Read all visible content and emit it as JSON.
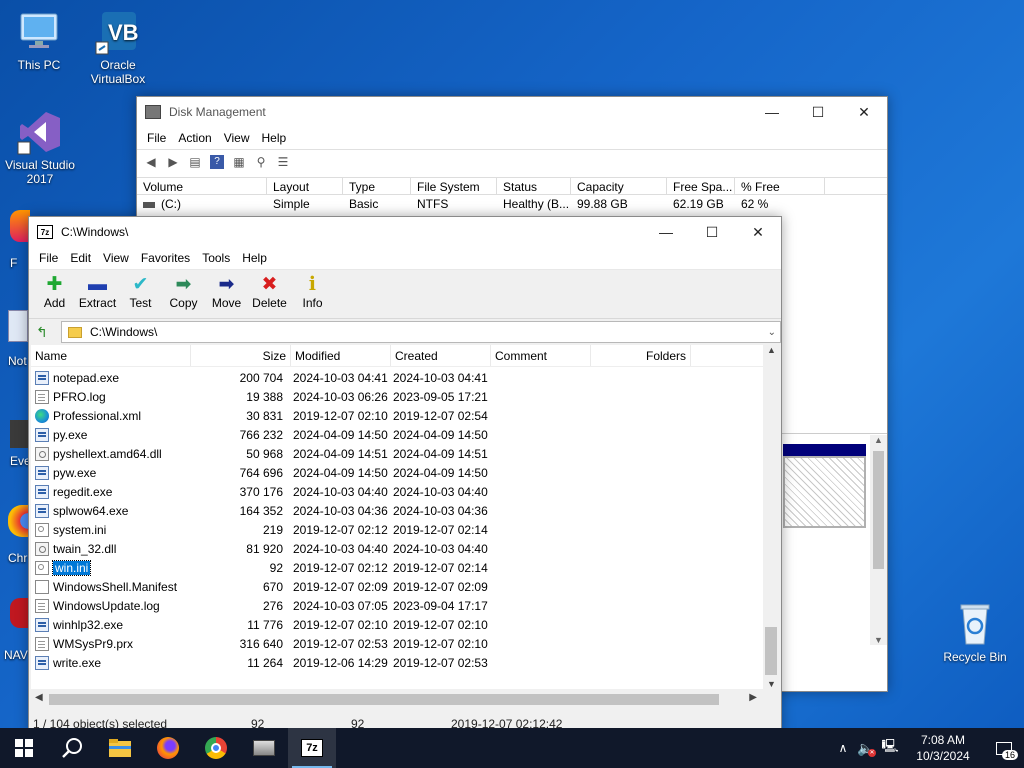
{
  "desktop": {
    "icons": [
      {
        "label": "This PC"
      },
      {
        "label": "Oracle VirtualBox"
      },
      {
        "label": "Visual Studio 2017"
      },
      {
        "label": "Recycle Bin"
      }
    ],
    "partial_labels": [
      "F",
      "Not",
      "Eve",
      "Chr",
      "NAV"
    ]
  },
  "disk_mgmt": {
    "title": "Disk Management",
    "menu": [
      "File",
      "Action",
      "View",
      "Help"
    ],
    "columns": [
      "Volume",
      "Layout",
      "Type",
      "File System",
      "Status",
      "Capacity",
      "Free Spa...",
      "% Free"
    ],
    "row": {
      "volume": "(C:)",
      "layout": "Simple",
      "type": "Basic",
      "fs": "NTFS",
      "status": "Healthy (B...",
      "capacity": "99.88 GB",
      "free": "62.19 GB",
      "pct": "62 %"
    }
  },
  "zip": {
    "title": "C:\\Windows\\",
    "menu": [
      "File",
      "Edit",
      "View",
      "Favorites",
      "Tools",
      "Help"
    ],
    "tools": [
      {
        "label": "Add",
        "icon": "plus-icon",
        "glyph": "✚",
        "color": "#1fa832"
      },
      {
        "label": "Extract",
        "icon": "minus-icon",
        "glyph": "▬",
        "color": "#1f3fb0"
      },
      {
        "label": "Test",
        "icon": "check-icon",
        "glyph": "✔",
        "color": "#2cb8c8"
      },
      {
        "label": "Copy",
        "icon": "copy-arrow-icon",
        "glyph": "➡",
        "color": "#2d8a5a"
      },
      {
        "label": "Move",
        "icon": "move-arrow-icon",
        "glyph": "➡",
        "color": "#1a2a8a"
      },
      {
        "label": "Delete",
        "icon": "delete-x-icon",
        "glyph": "✖",
        "color": "#d81e1e"
      },
      {
        "label": "Info",
        "icon": "info-icon",
        "glyph": "ℹ",
        "color": "#c8a800"
      }
    ],
    "address": "C:\\Windows\\",
    "columns": [
      "Name",
      "Size",
      "Modified",
      "Created",
      "Comment",
      "Folders"
    ],
    "files": [
      {
        "name": "notepad.exe",
        "size": "200 704",
        "modified": "2024-10-03 04:41",
        "created": "2024-10-03 04:41",
        "type": "exe"
      },
      {
        "name": "PFRO.log",
        "size": "19 388",
        "modified": "2024-10-03 06:26",
        "created": "2023-09-05 17:21",
        "type": "txt"
      },
      {
        "name": "Professional.xml",
        "size": "30 831",
        "modified": "2019-12-07 02:10",
        "created": "2019-12-07 02:54",
        "type": "xml"
      },
      {
        "name": "py.exe",
        "size": "766 232",
        "modified": "2024-04-09 14:50",
        "created": "2024-04-09 14:50",
        "type": "exe"
      },
      {
        "name": "pyshellext.amd64.dll",
        "size": "50 968",
        "modified": "2024-04-09 14:51",
        "created": "2024-04-09 14:51",
        "type": "dll"
      },
      {
        "name": "pyw.exe",
        "size": "764 696",
        "modified": "2024-04-09 14:50",
        "created": "2024-04-09 14:50",
        "type": "exe"
      },
      {
        "name": "regedit.exe",
        "size": "370 176",
        "modified": "2024-10-03 04:40",
        "created": "2024-10-03 04:40",
        "type": "exe"
      },
      {
        "name": "splwow64.exe",
        "size": "164 352",
        "modified": "2024-10-03 04:36",
        "created": "2024-10-03 04:36",
        "type": "exe"
      },
      {
        "name": "system.ini",
        "size": "219",
        "modified": "2019-12-07 02:12",
        "created": "2019-12-07 02:14",
        "type": "ini"
      },
      {
        "name": "twain_32.dll",
        "size": "81 920",
        "modified": "2024-10-03 04:40",
        "created": "2024-10-03 04:40",
        "type": "dll"
      },
      {
        "name": "win.ini",
        "size": "92",
        "modified": "2019-12-07 02:12",
        "created": "2019-12-07 02:14",
        "type": "ini",
        "selected": true
      },
      {
        "name": "WindowsShell.Manifest",
        "size": "670",
        "modified": "2019-12-07 02:09",
        "created": "2019-12-07 02:09",
        "type": "blank"
      },
      {
        "name": "WindowsUpdate.log",
        "size": "276",
        "modified": "2024-10-03 07:05",
        "created": "2023-09-04 17:17",
        "type": "txt"
      },
      {
        "name": "winhlp32.exe",
        "size": "11 776",
        "modified": "2019-12-07 02:10",
        "created": "2019-12-07 02:10",
        "type": "exe"
      },
      {
        "name": "WMSysPr9.prx",
        "size": "316 640",
        "modified": "2019-12-07 02:53",
        "created": "2019-12-07 02:10",
        "type": "txt"
      },
      {
        "name": "write.exe",
        "size": "11 264",
        "modified": "2019-12-06 14:29",
        "created": "2019-12-07 02:53",
        "type": "exe"
      }
    ],
    "status": {
      "selection": "1 / 104 object(s) selected",
      "size1": "92",
      "size2": "92",
      "date": "2019-12-07 02:12:42"
    }
  },
  "taskbar": {
    "time": "7:08 AM",
    "date": "10/3/2024",
    "notifications": "16"
  }
}
